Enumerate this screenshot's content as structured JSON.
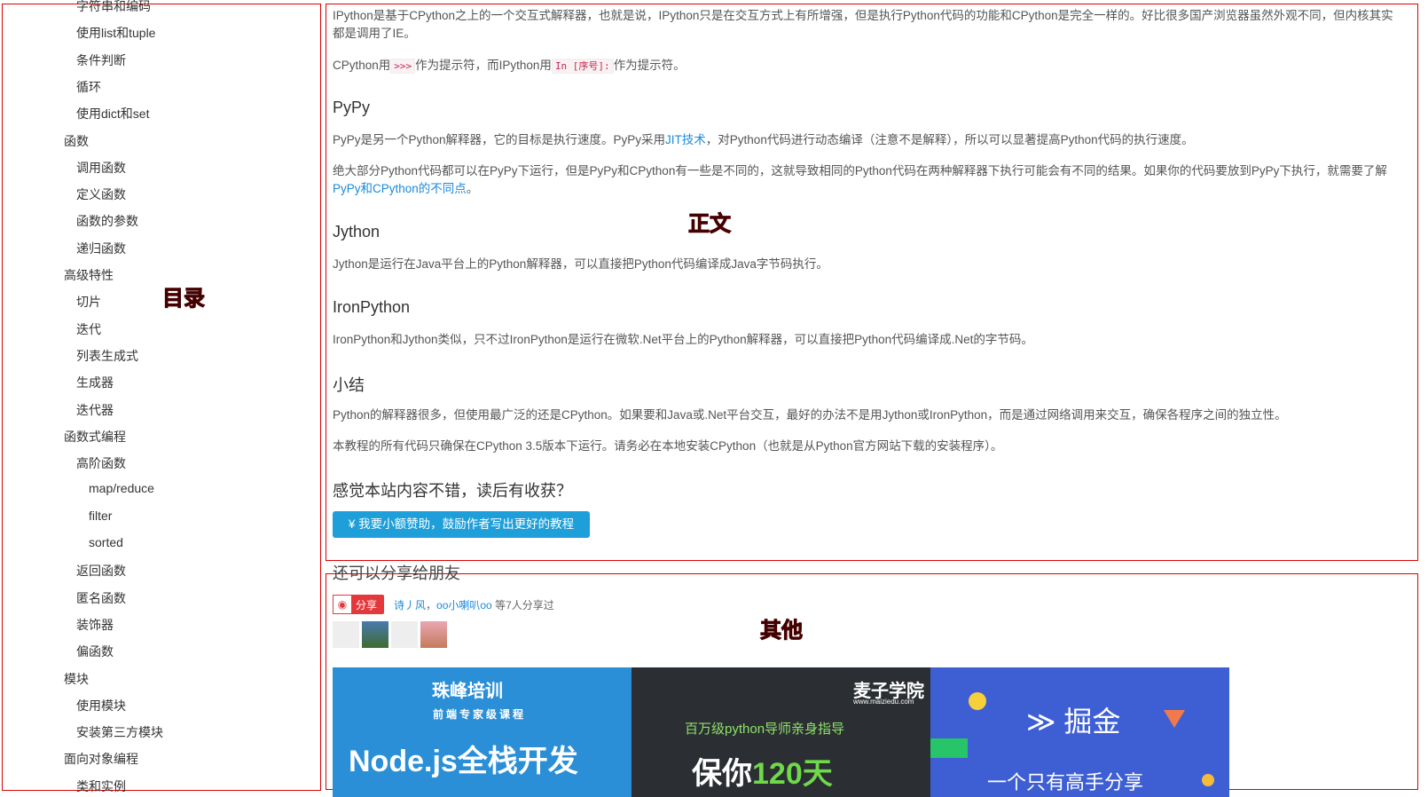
{
  "sidebar": {
    "label": "目录",
    "items": [
      {
        "label": "字符串和编码",
        "level": 2
      },
      {
        "label": "使用list和tuple",
        "level": 2
      },
      {
        "label": "条件判断",
        "level": 2
      },
      {
        "label": "循环",
        "level": 2
      },
      {
        "label": "使用dict和set",
        "level": 2
      },
      {
        "label": "函数",
        "level": 1
      },
      {
        "label": "调用函数",
        "level": 2
      },
      {
        "label": "定义函数",
        "level": 2
      },
      {
        "label": "函数的参数",
        "level": 2
      },
      {
        "label": "递归函数",
        "level": 2
      },
      {
        "label": "高级特性",
        "level": 1
      },
      {
        "label": "切片",
        "level": 2
      },
      {
        "label": "迭代",
        "level": 2
      },
      {
        "label": "列表生成式",
        "level": 2
      },
      {
        "label": "生成器",
        "level": 2
      },
      {
        "label": "迭代器",
        "level": 2
      },
      {
        "label": "函数式编程",
        "level": 1
      },
      {
        "label": "高阶函数",
        "level": 2
      },
      {
        "label": "map/reduce",
        "level": 3
      },
      {
        "label": "filter",
        "level": 3
      },
      {
        "label": "sorted",
        "level": 3
      },
      {
        "label": "返回函数",
        "level": 2
      },
      {
        "label": "匿名函数",
        "level": 2
      },
      {
        "label": "装饰器",
        "level": 2
      },
      {
        "label": "偏函数",
        "level": 2
      },
      {
        "label": "模块",
        "level": 1
      },
      {
        "label": "使用模块",
        "level": 2
      },
      {
        "label": "安装第三方模块",
        "level": 2
      },
      {
        "label": "面向对象编程",
        "level": 1
      },
      {
        "label": "类和实例",
        "level": 2
      }
    ]
  },
  "content": {
    "label": "正文",
    "ipython_p1": "IPython是基于CPython之上的一个交互式解释器，也就是说，IPython只是在交互方式上有所增强，但是执行Python代码的功能和CPython是完全一样的。好比很多国产浏览器虽然外观不同，但内核其实都是调用了IE。",
    "ipython_p2_a": "CPython用",
    "ipython_p2_code1": ">>>",
    "ipython_p2_b": "作为提示符，而IPython用",
    "ipython_p2_code2": "In [序号]:",
    "ipython_p2_c": "作为提示符。",
    "pypy_title": "PyPy",
    "pypy_p1_a": "PyPy是另一个Python解释器，它的目标是执行速度。PyPy采用",
    "pypy_p1_link": "JIT技术",
    "pypy_p1_b": "，对Python代码进行动态编译（注意不是解释），所以可以显著提高Python代码的执行速度。",
    "pypy_p2_a": "绝大部分Python代码都可以在PyPy下运行，但是PyPy和CPython有一些是不同的，这就导致相同的Python代码在两种解释器下执行可能会有不同的结果。如果你的代码要放到PyPy下执行，就需要了解",
    "pypy_p2_link": "PyPy和CPython的不同点",
    "pypy_p2_b": "。",
    "jython_title": "Jython",
    "jython_p1": "Jython是运行在Java平台上的Python解释器，可以直接把Python代码编译成Java字节码执行。",
    "ironpython_title": "IronPython",
    "ironpython_p1": "IronPython和Jython类似，只不过IronPython是运行在微软.Net平台上的Python解释器，可以直接把Python代码编译成.Net的字节码。",
    "summary_title": "小结",
    "summary_p1": "Python的解释器很多，但使用最广泛的还是CPython。如果要和Java或.Net平台交互，最好的办法不是用Jython或IronPython，而是通过网络调用来交互，确保各程序之间的独立性。",
    "summary_p2": "本教程的所有代码只确保在CPython 3.5版本下运行。请务必在本地安装CPython（也就是从Python官方网站下载的安装程序）。",
    "feedback_title": "感觉本站内容不错，读后有收获？",
    "donate_button": "¥ 我要小额赞助，鼓励作者写出更好的教程"
  },
  "other": {
    "label": "其他",
    "share_title": "还可以分享给朋友",
    "share_button": "分享",
    "sharers_a": "诗丿风",
    "sharers_sep": "，",
    "sharers_b": "oo小喇叭oo",
    "sharers_suffix": "等7人分享过",
    "banners": [
      {
        "brand": "珠峰培训",
        "sub": "前端专家级课程",
        "headline": "Node.js全栈开发",
        "color": "#2a8fd6"
      },
      {
        "brand": "麦子学院",
        "site": "www.maiziedu.com",
        "sub": "百万级python导师亲身指导",
        "headline_a": "保你",
        "headline_b": "120天",
        "color": "#2b2e33"
      },
      {
        "brand": "掘金",
        "headline": "一个只有高手分享",
        "color": "#3e5fd4"
      }
    ]
  },
  "colors": {
    "frame": "#dd0000",
    "link": "#1a8ad9",
    "button": "#1e9fd9"
  }
}
